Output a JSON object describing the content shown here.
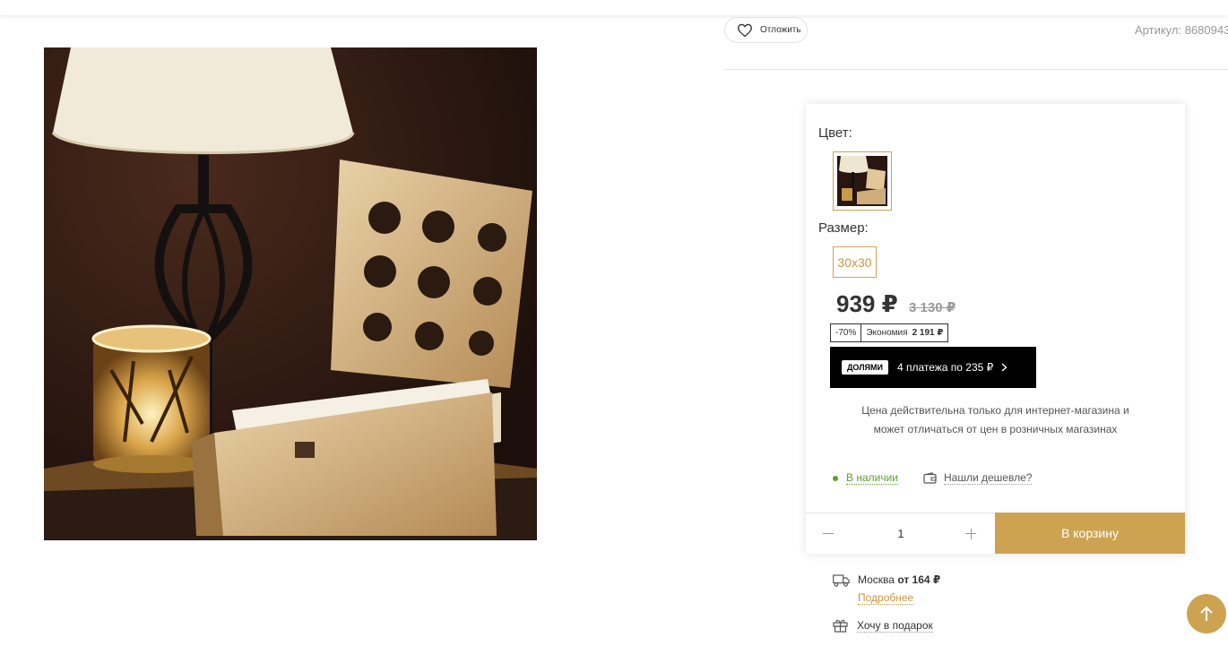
{
  "header": {
    "wishlist_label": "Отложить",
    "sku_label": "Артикул:",
    "sku_value": "8680943"
  },
  "product": {
    "color_label": "Цвет:",
    "size_label": "Размер:",
    "size_selected": "30x30",
    "price": "939 ₽",
    "old_price": "3 130 ₽",
    "discount": "-70%",
    "savings_label": "Экономия",
    "savings_value": "2 191 ₽",
    "installments_logo": "ДОЛЯМИ",
    "installments_text": "4 платежа по 235 ₽",
    "price_note": "Цена действительна только для интернет-магазина и может отличаться от цен в розничных магазинах",
    "stock": "В наличии",
    "cheaper": "Нашли дешевле?",
    "quantity": "1",
    "add_to_cart": "В корзину"
  },
  "delivery": {
    "city": "Москва",
    "from_label": "от 164 ₽",
    "more": "Подробнее"
  },
  "gift": "Хочу в подарок",
  "colors": {
    "accent": "#cda351",
    "in_stock": "#5da12d",
    "installments_bg": "#000000"
  }
}
